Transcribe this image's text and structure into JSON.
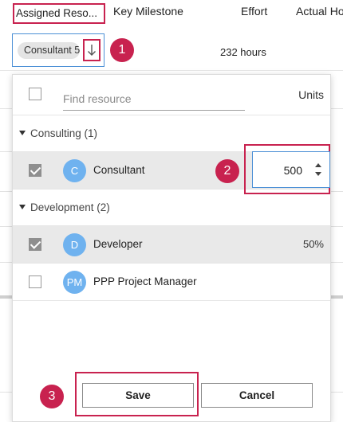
{
  "columns": {
    "assigned": "Assigned Reso...",
    "milestone": "Key Milestone",
    "effort": "Effort",
    "actual": "Actual Ho"
  },
  "row": {
    "resource_pill": "Consultant 5",
    "effort": "232 hours"
  },
  "callouts": [
    "1",
    "2",
    "3"
  ],
  "popup": {
    "search_placeholder": "Find resource",
    "units_header": "Units",
    "groups": [
      {
        "label": "Consulting (1)",
        "resources": [
          {
            "initials": "C",
            "name": "Consultant",
            "checked": true,
            "units_input": "500"
          }
        ]
      },
      {
        "label": "Development (2)",
        "resources": [
          {
            "initials": "D",
            "name": "Developer",
            "checked": true,
            "units": "50%"
          },
          {
            "initials": "PM",
            "name": "PPP Project Manager",
            "checked": false,
            "units": ""
          }
        ]
      }
    ],
    "save_label": "Save",
    "cancel_label": "Cancel"
  },
  "colors": {
    "accent_outline": "#c8224f",
    "avatar": "#6fb2ef",
    "focus_border": "#4c90d6"
  }
}
